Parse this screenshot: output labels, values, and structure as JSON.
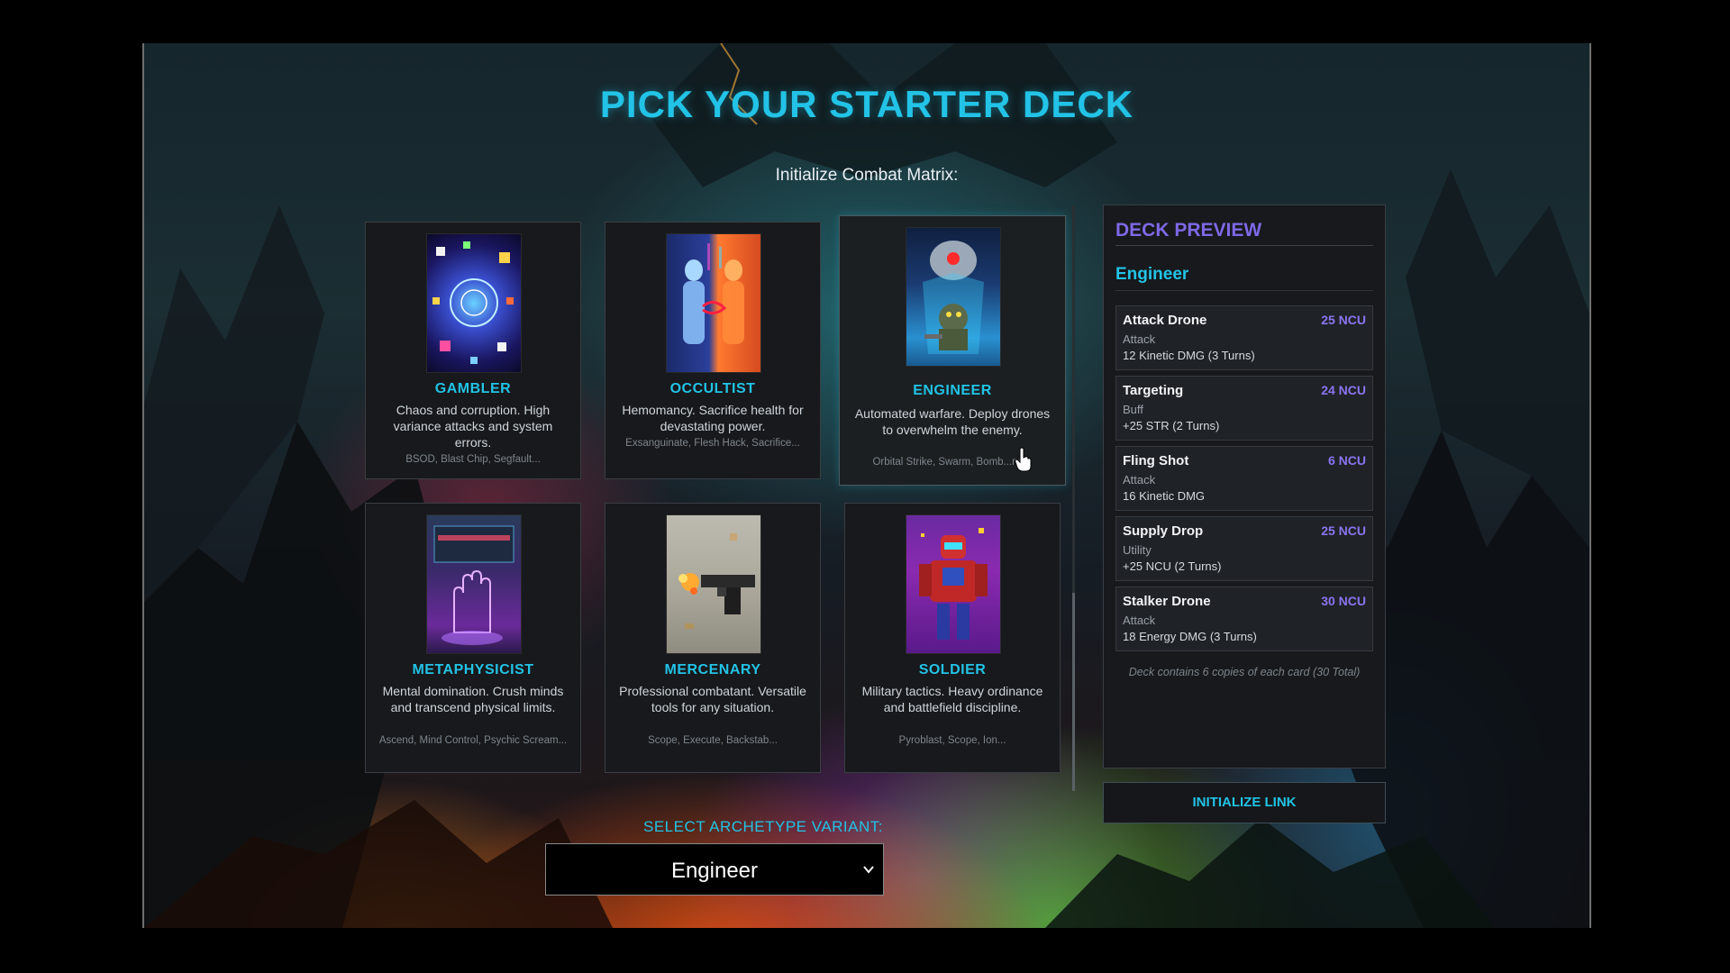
{
  "screen": {
    "title": "PICK YOUR STARTER DECK",
    "subtitle": "Initialize Combat Matrix:"
  },
  "archetypes": [
    {
      "name": "GAMBLER",
      "description": "Chaos and corruption. High variance attacks and system errors.",
      "cards": "BSOD, Blast Chip, Segfault...",
      "art_icon": "dice-portal-icon"
    },
    {
      "name": "OCCULTIST",
      "description": "Hemomancy. Sacrifice health for devastating power.",
      "cards": "Exsanguinate, Flesh Hack, Sacrifice...",
      "art_icon": "blood-figures-icon"
    },
    {
      "name": "ENGINEER",
      "description": "Automated warfare. Deploy drones to overwhelm the enemy.",
      "cards": "Orbital Strike, Swarm, Bomb...ne...",
      "art_icon": "drone-robot-icon",
      "selected": true
    },
    {
      "name": "METAPHYSICIST",
      "description": "Mental domination. Crush minds and transcend physical limits.",
      "cards": "Ascend, Mind Control, Psychic Scream...",
      "art_icon": "psychic-hand-icon"
    },
    {
      "name": "MERCENARY",
      "description": "Professional combatant. Versatile tools for any situation.",
      "cards": "Scope, Execute, Backstab...",
      "art_icon": "pistol-icon"
    },
    {
      "name": "SOLDIER",
      "description": "Military tactics. Heavy ordinance and battlefield discipline.",
      "cards": "Pyroblast, Scope, Ion...",
      "art_icon": "armored-soldier-icon"
    }
  ],
  "variant": {
    "label": "SELECT ARCHETYPE VARIANT:",
    "selected": "Engineer"
  },
  "preview": {
    "title": "DECK PREVIEW",
    "deck_name": "Engineer",
    "cards": [
      {
        "name": "Attack Drone",
        "cost": "25 NCU",
        "type": "Attack",
        "effect": "12 Kinetic DMG (3 Turns)"
      },
      {
        "name": "Targeting",
        "cost": "24 NCU",
        "type": "Buff",
        "effect": "+25 STR (2 Turns)"
      },
      {
        "name": "Fling Shot",
        "cost": "6 NCU",
        "type": "Attack",
        "effect": "16 Kinetic DMG"
      },
      {
        "name": "Supply Drop",
        "cost": "25 NCU",
        "type": "Utility",
        "effect": "+25 NCU (2 Turns)"
      },
      {
        "name": "Stalker Drone",
        "cost": "30 NCU",
        "type": "Attack",
        "effect": "18 Energy DMG (3 Turns)"
      }
    ],
    "note": "Deck contains 6 copies of each card (30 Total)",
    "button_label": "INITIALIZE LINK"
  },
  "colors": {
    "accent_cyan": "#22c3e6",
    "accent_purple": "#7f68e6",
    "panel_bg": "#17191c"
  }
}
